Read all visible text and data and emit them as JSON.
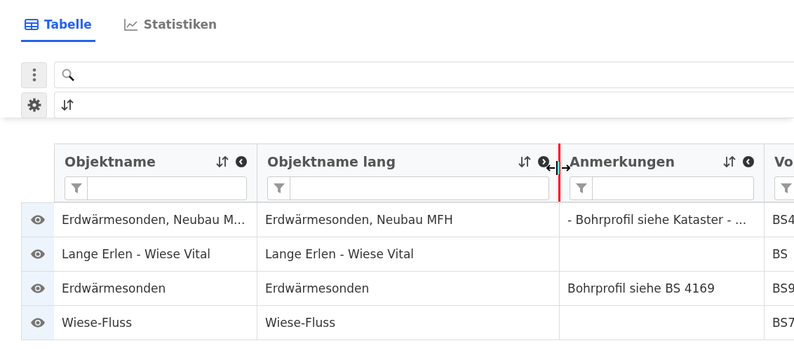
{
  "tabs": [
    {
      "label": "Tabelle",
      "selected": true
    },
    {
      "label": "Statistiken",
      "selected": false
    }
  ],
  "table": {
    "columns": [
      {
        "title": "Objektname",
        "kind": "collapse-left"
      },
      {
        "title": "Objektname lang",
        "kind": "collapse-right"
      },
      {
        "title": "Anmerkungen",
        "kind": "collapse-left"
      },
      {
        "title": "Vo",
        "kind": "cut"
      }
    ],
    "rows": [
      [
        "Erdwärmesonden, Neubau M...",
        "Erdwärmesonden, Neubau MFH",
        "- Bohrprofil siehe Kataster - ...",
        "BS4"
      ],
      [
        "Lange Erlen - Wiese Vital",
        "Lange Erlen - Wiese Vital",
        "",
        "BS"
      ],
      [
        "Erdwärmesonden",
        "Erdwärmesonden",
        "Bohrprofil siehe BS 4169",
        "BS9"
      ],
      [
        "Wiese-Fluss",
        "Wiese-Fluss",
        "",
        "BS7"
      ]
    ]
  }
}
